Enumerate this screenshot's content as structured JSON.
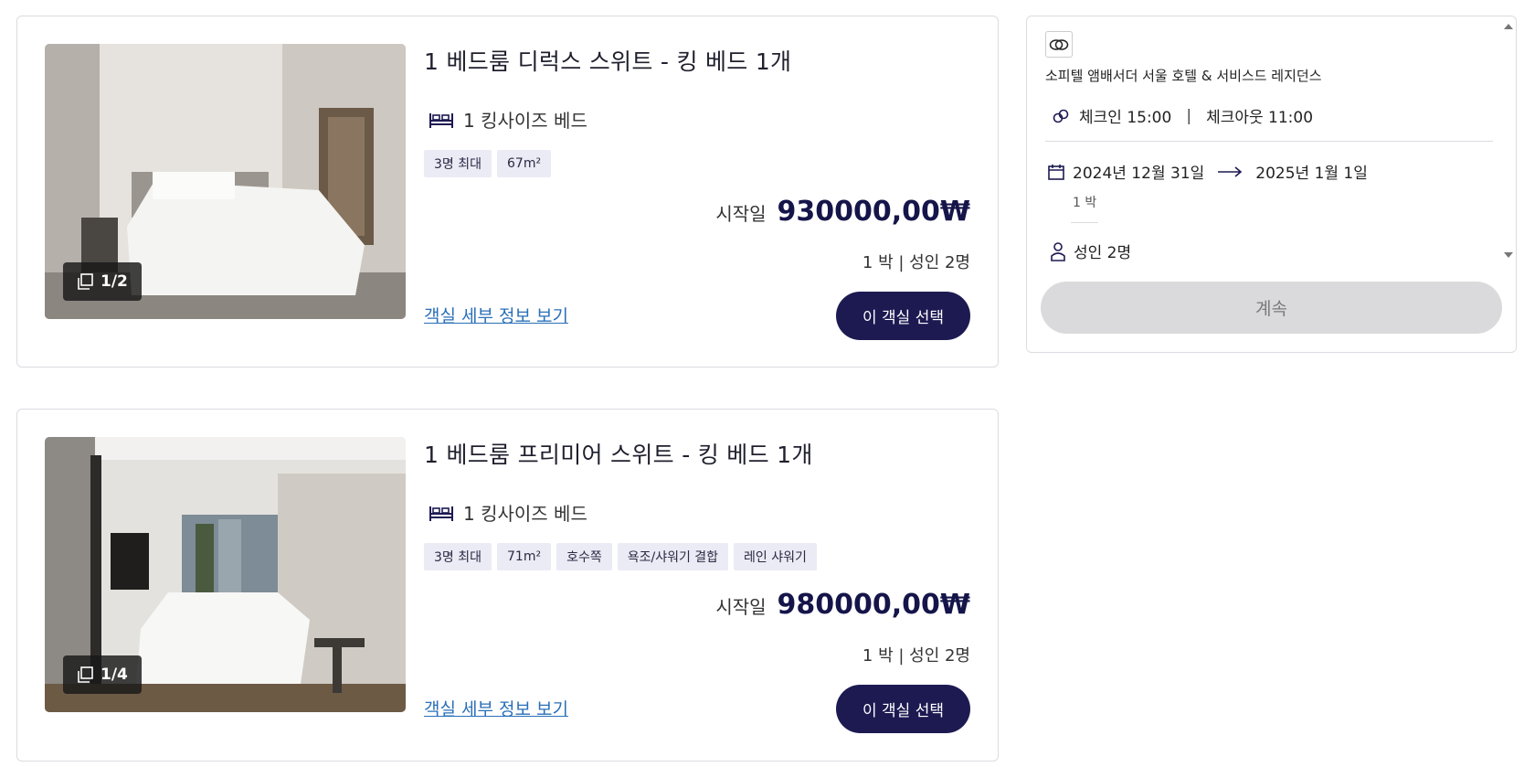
{
  "rooms": [
    {
      "title": "1 베드룸 디럭스 스위트 - 킹 베드 1개",
      "bed": "1 킹사이즈 베드",
      "tags": [
        "3명 최대",
        "67m²"
      ],
      "price_prefix": "시작일",
      "price": "930000,00₩",
      "stay": "1 박 | 성인 2명",
      "details_link": "객실 세부 정보 보기",
      "select_label": "이 객실 선택",
      "photo_counter": "1/2"
    },
    {
      "title": "1 베드룸 프리미어 스위트 - 킹 베드 1개",
      "bed": "1 킹사이즈 베드",
      "tags": [
        "3명 최대",
        "71m²",
        "호수쪽",
        "욕조/샤워기 결합",
        "레인 샤워기"
      ],
      "price_prefix": "시작일",
      "price": "980000,00₩",
      "stay": "1 박 | 성인 2명",
      "details_link": "객실 세부 정보 보기",
      "select_label": "이 객실 선택",
      "photo_counter": "1/4"
    }
  ],
  "summary": {
    "hotel_name": "소피텔 앰배서더 서울 호텔 & 서비스드 레지던스",
    "check_in": "체크인 15:00",
    "separator": "|",
    "check_out": "체크아웃 11:00",
    "date_from": "2024년 12월 31일",
    "date_to": "2025년 1월 1일",
    "nights": "1 박",
    "guests": "성인 2명",
    "continue_label": "계속"
  },
  "colors": {
    "primary": "#1d1a52",
    "link": "#2a6fb8",
    "tag_bg": "#ebebf5",
    "disabled_btn": "#dadadc"
  }
}
